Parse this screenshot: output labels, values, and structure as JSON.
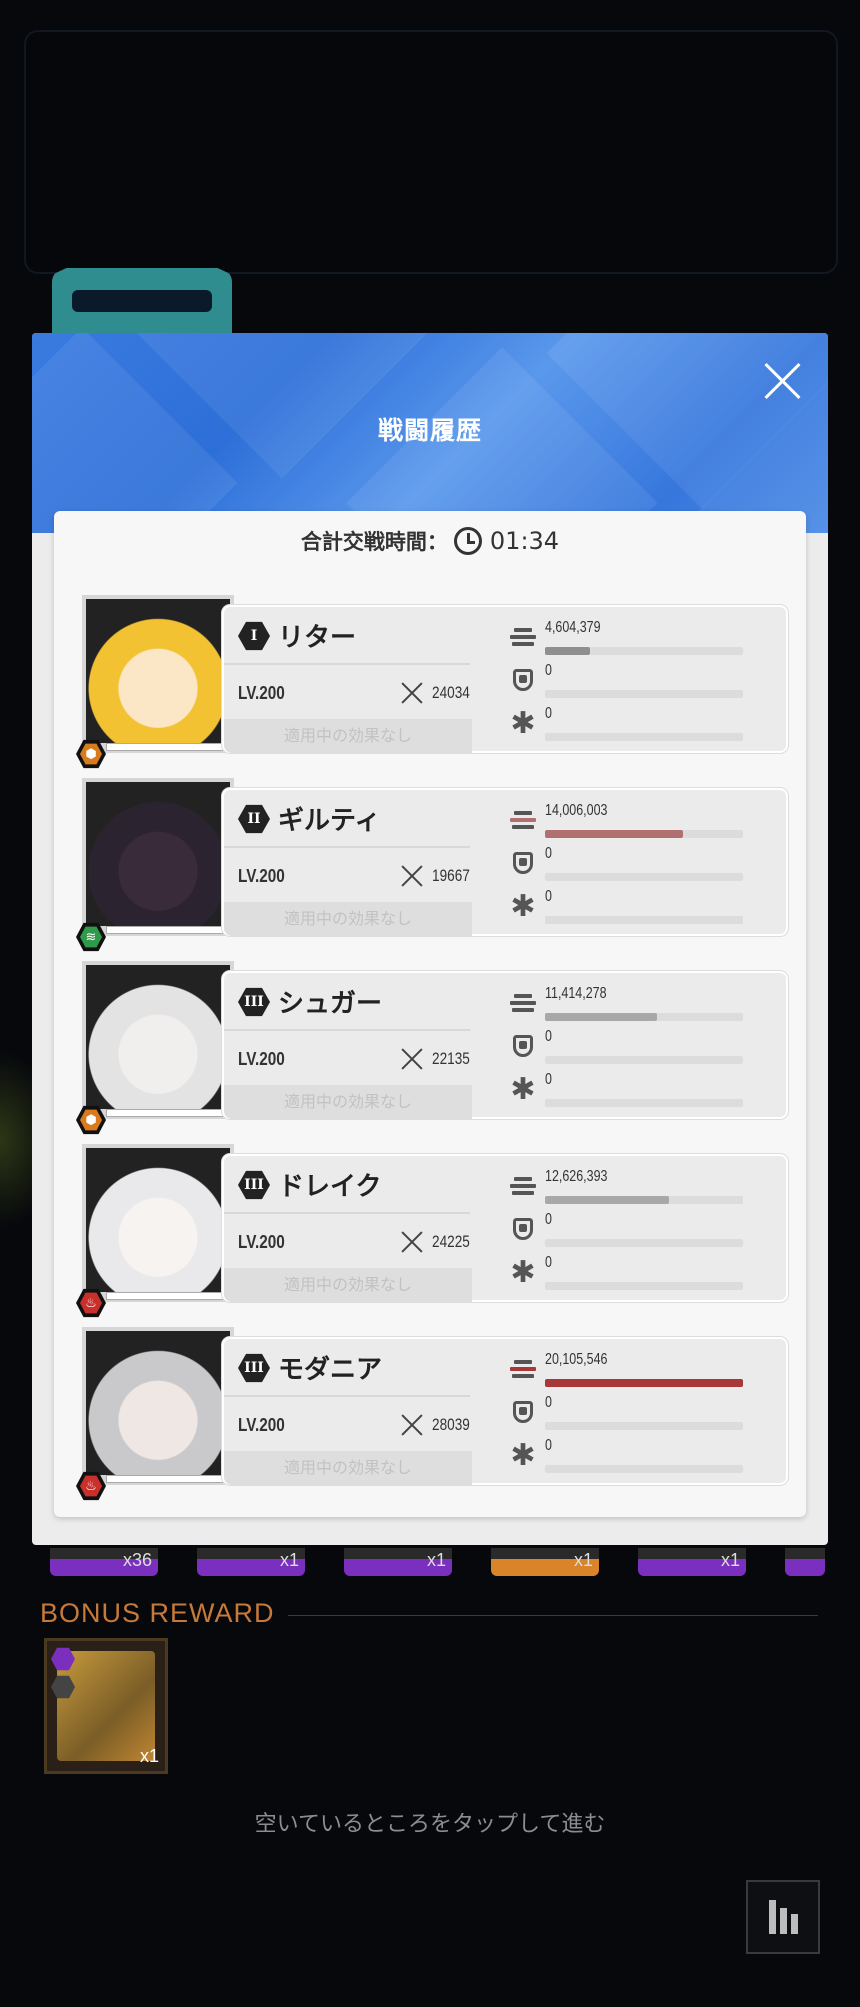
{
  "modal": {
    "title": "戦闘履歴",
    "total_label": "合計交戦時間：",
    "total_time": "01:34"
  },
  "characters": [
    {
      "rank": "I",
      "name": "リター",
      "level": "LV.200",
      "power": "24034",
      "effect": "適用中の効果なし",
      "damage": "4,604,379",
      "damage_ratio": 0.229,
      "damage_color": "#8f8f8f",
      "shield": "0",
      "heal": "0",
      "element": "Iron",
      "element_color": "#d97a1c",
      "element_glyph": "⬢"
    },
    {
      "rank": "II",
      "name": "ギルティ",
      "level": "LV.200",
      "power": "19667",
      "effect": "適用中の効果なし",
      "damage": "14,006,003",
      "damage_ratio": 0.697,
      "damage_color": "#b07070",
      "shield": "0",
      "heal": "0",
      "element": "Wind",
      "element_color": "#2e9a4a",
      "element_glyph": "≋"
    },
    {
      "rank": "III",
      "name": "シュガー",
      "level": "LV.200",
      "power": "22135",
      "effect": "適用中の効果なし",
      "damage": "11,414,278",
      "damage_ratio": 0.568,
      "damage_color": "#a8a8a8",
      "shield": "0",
      "heal": "0",
      "element": "Iron",
      "element_color": "#d97a1c",
      "element_glyph": "⬢"
    },
    {
      "rank": "III",
      "name": "ドレイク",
      "level": "LV.200",
      "power": "24225",
      "effect": "適用中の効果なし",
      "damage": "12,626,393",
      "damage_ratio": 0.628,
      "damage_color": "#a8a8a8",
      "shield": "0",
      "heal": "0",
      "element": "Fire",
      "element_color": "#c9302c",
      "element_glyph": "♨"
    },
    {
      "rank": "III",
      "name": "モダニア",
      "level": "LV.200",
      "power": "28039",
      "effect": "適用中の効果なし",
      "damage": "20,105,546",
      "damage_ratio": 1.0,
      "damage_color": "#a83838",
      "shield": "0",
      "heal": "0",
      "element": "Fire",
      "element_color": "#c9302c",
      "element_glyph": "♨"
    }
  ],
  "reward_strip": [
    {
      "qty": "x36",
      "color": "#7b2fbf"
    },
    {
      "qty": "x1",
      "color": "#7b2fbf"
    },
    {
      "qty": "x1",
      "color": "#7b2fbf"
    },
    {
      "qty": "x1",
      "color": "#d9832a"
    },
    {
      "qty": "x1",
      "color": "#7b2fbf"
    },
    {
      "qty": "",
      "color": "#7b2fbf"
    }
  ],
  "bonus": {
    "label": "BONUS REWARD",
    "item_qty": "x1"
  },
  "tap_hint": "空いているところをタップして進む",
  "icons": {
    "close": "close-icon",
    "clock": "clock-icon",
    "damage": "damage-bars-icon",
    "shield": "shield-icon",
    "heal": "asterisk-icon",
    "power": "crossed-swords-icon",
    "stats": "bar-chart-icon"
  }
}
